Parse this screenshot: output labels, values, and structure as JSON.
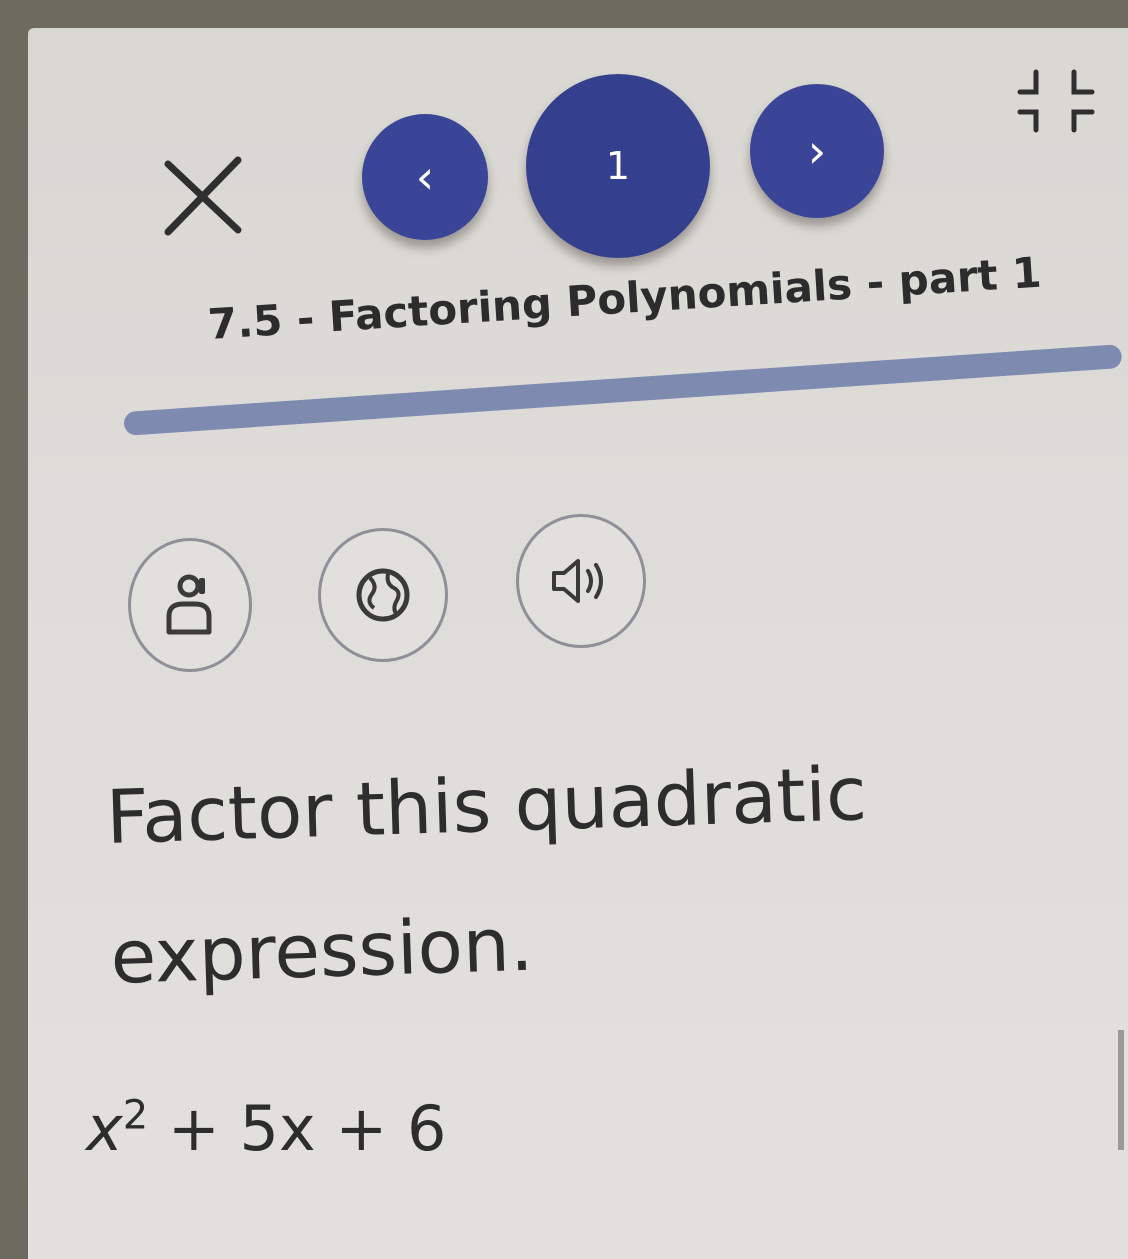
{
  "nav": {
    "close": {
      "icon": "close-icon",
      "color": "#2f2f2f"
    },
    "prev": {
      "icon": "chevron-left-icon",
      "glyph": "‹"
    },
    "page_number": "1",
    "next": {
      "icon": "chevron-right-icon",
      "glyph": "›"
    },
    "collapse": {
      "icon": "collapse-icon"
    },
    "accent_color": "#34408e"
  },
  "lesson": {
    "title": "7.5 - Factoring Polynomials - part 1",
    "progress": 1.0
  },
  "tools": [
    {
      "icon": "glossary-person-icon"
    },
    {
      "icon": "globe-icon"
    },
    {
      "icon": "speaker-icon"
    }
  ],
  "question": {
    "prompt": "Factor this quadratic expression.",
    "expression": {
      "variable": "x",
      "exponent": "2",
      "rest": " + 5x + 6"
    }
  }
}
